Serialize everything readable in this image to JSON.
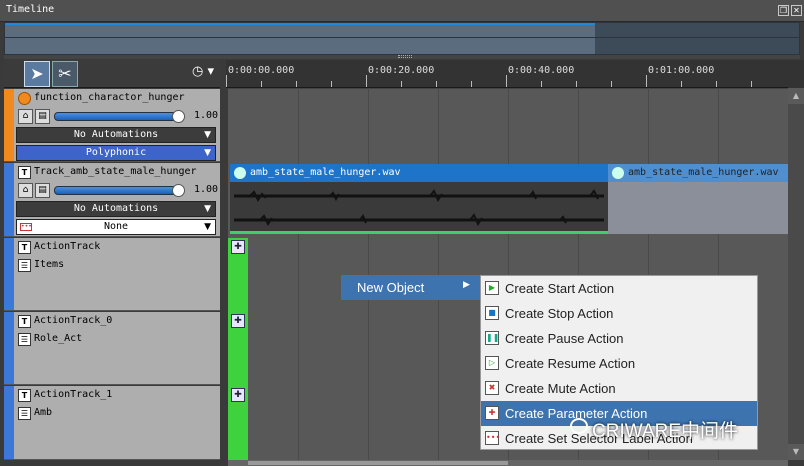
{
  "window": {
    "title": "Timeline",
    "restore_icon": "restore-icon",
    "close_icon": "close-icon"
  },
  "toolbar": {
    "select_tool": "arrow-icon",
    "cut_tool": "scissors-icon",
    "time_icon": "clock-icon"
  },
  "ruler": {
    "labels": [
      "0:00:00.000",
      "0:00:20.000",
      "0:00:40.000",
      "0:01:00.000"
    ]
  },
  "tracks": [
    {
      "name": "function_charactor_hunger",
      "color": "#f08a1e",
      "volume": "1.00",
      "automation": "No Automations",
      "mode": "Polyphonic"
    },
    {
      "name": "Track_amb_state_male_hunger",
      "color": "#3b78d8",
      "volume": "1.00",
      "automation": "No Automations",
      "mode": "None"
    },
    {
      "name": "ActionTrack",
      "sub": "Items"
    },
    {
      "name": "ActionTrack_0",
      "sub": "Role_Act"
    },
    {
      "name": "ActionTrack_1",
      "sub": "Amb"
    }
  ],
  "clips": [
    {
      "label": "amb_state_male_hunger.wav",
      "color": "#1e74c8"
    },
    {
      "label": "amb_state_male_hunger.wav",
      "color": "#4f8fcf"
    }
  ],
  "context_menu": {
    "parent": "New Object",
    "items": [
      {
        "label": "Create Start Action",
        "icon": "start-action-icon"
      },
      {
        "label": "Create Stop Action",
        "icon": "stop-action-icon"
      },
      {
        "label": "Create Pause Action",
        "icon": "pause-action-icon"
      },
      {
        "label": "Create Resume Action",
        "icon": "resume-action-icon"
      },
      {
        "label": "Create Mute Action",
        "icon": "mute-action-icon"
      },
      {
        "label": "Create Parameter Action",
        "icon": "parameter-action-icon"
      },
      {
        "label": "Create Set Selector Label Action",
        "icon": "selector-action-icon"
      }
    ],
    "active_index": 5
  },
  "watermark": {
    "text": "CRIWARE中间件"
  }
}
